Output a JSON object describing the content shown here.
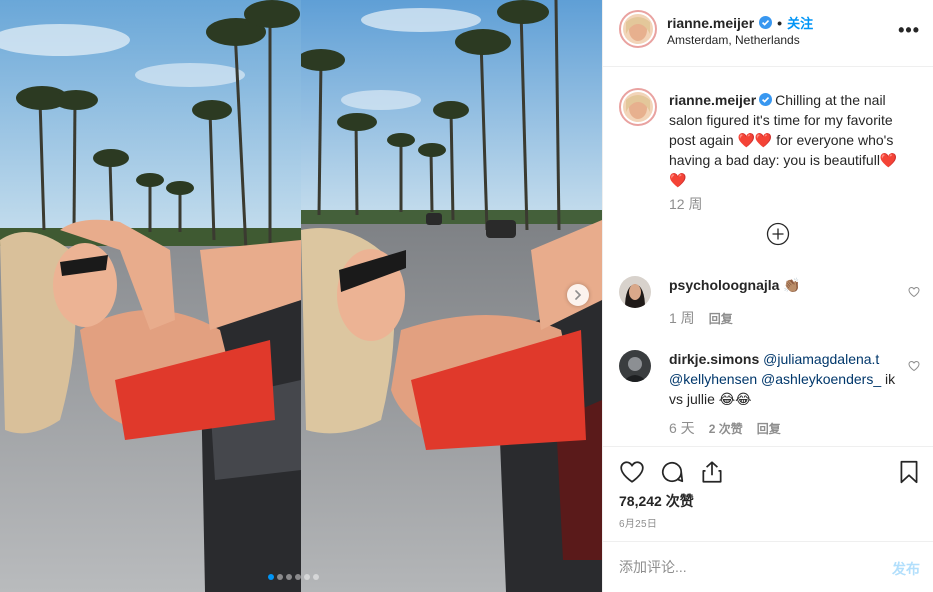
{
  "post": {
    "carousel": {
      "slide_count": 6,
      "active_slide": 1
    },
    "header": {
      "username": "rianne.meijer",
      "follow_label": "关注",
      "location": "Amsterdam, Netherlands",
      "more_label": "•••"
    },
    "caption": {
      "username": "rianne.meijer",
      "text": "Chilling at the nail salon figured it's time for my favorite post again ❤️❤️ for everyone who's having a bad day: you is beautifull❤️❤️",
      "time": "12 周"
    },
    "comments": [
      {
        "username": "psycholoognajla",
        "text": "👏🏽",
        "time": "1 周",
        "reply_label": "回复"
      },
      {
        "username": "dirkje.simons",
        "mentions": [
          "@juliamagdalena.t",
          "@kellyhensen",
          "@ashleykoenders_"
        ],
        "text": "ik vs jullie 😂😂",
        "time": "6 天",
        "likes_label": "2 次赞",
        "reply_label": "回复"
      }
    ],
    "likes": "78,242 次赞",
    "date": "6月25日",
    "composer": {
      "placeholder": "添加评论...",
      "post_label": "发布"
    },
    "colors": {
      "accent": "#0095f6",
      "post_disabled": "#b2dffc",
      "muted": "#8e8e8e"
    }
  }
}
